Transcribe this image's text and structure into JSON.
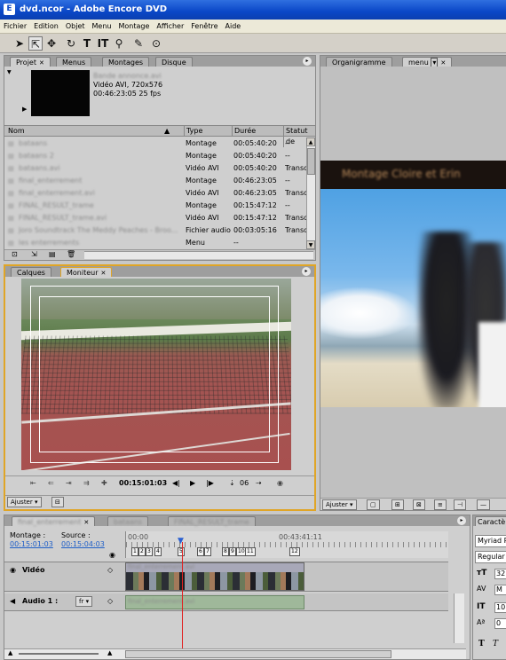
{
  "window": {
    "title": "dvd.ncor - Adobe Encore DVD",
    "icon": "app-icon"
  },
  "menu": [
    "Fichier",
    "Edition",
    "Objet",
    "Menu",
    "Montage",
    "Afficher",
    "Fenêtre",
    "Aide"
  ],
  "tools": [
    "selection-tool-icon",
    "direct-select-tool-icon",
    "move-tool-icon",
    "rotate-tool-icon",
    "text-tool-icon",
    "vertical-text-tool-icon",
    "zoom-tool-icon",
    "edit-tool-icon",
    "preview-tool-icon"
  ],
  "project": {
    "tabs": [
      "Projet",
      "Menus",
      "Montages",
      "Disque"
    ],
    "preview": {
      "name": "Bande annonce.avi",
      "type": "Vidéo AVI, 720x576",
      "duration": "00:46:23:05 25 fps"
    },
    "columns": [
      "Nom",
      "Type",
      "Durée",
      "Statut de"
    ],
    "rows": [
      {
        "name": "bataans",
        "type": "Montage",
        "duration": "00:05:40:20",
        "status": "--"
      },
      {
        "name": "bataans 2",
        "type": "Montage",
        "duration": "00:05:40:20",
        "status": "--"
      },
      {
        "name": "bataans.avi",
        "type": "Vidéo AVI",
        "duration": "00:05:40:20",
        "status": "Transc"
      },
      {
        "name": "final_enterrement",
        "type": "Montage",
        "duration": "00:46:23:05",
        "status": "--"
      },
      {
        "name": "final_enterrement.avi",
        "type": "Vidéo AVI",
        "duration": "00:46:23:05",
        "status": "Transc"
      },
      {
        "name": "FINAL_RESULT_trame",
        "type": "Montage",
        "duration": "00:15:47:12",
        "status": "--"
      },
      {
        "name": "FINAL_RESULT_trame.avi",
        "type": "Vidéo AVI",
        "duration": "00:15:47:12",
        "status": "Transc"
      },
      {
        "name": "Joro Soundtrack The Meddy Peaches - Broo...",
        "type": "Fichier audio",
        "duration": "00:03:05:16",
        "status": "Transc"
      },
      {
        "name": "les enterrements",
        "type": "Menu",
        "duration": "--",
        "status": ""
      }
    ]
  },
  "layers_monitor": {
    "tabs": [
      "Calques",
      "Moniteur"
    ]
  },
  "monitor": {
    "timecode": "00:15:01:03",
    "chapter": "06",
    "fit": "Ajuster"
  },
  "organigramme": {
    "tabs": [
      "Organigramme",
      "menu"
    ],
    "menu_text": "Montage Cloire et Erin",
    "fit": "Ajuster"
  },
  "timeline": {
    "tabs": [
      "final_enterrement",
      "bataans",
      "FINAL_RESULT_trame"
    ],
    "montage_label": "Montage :",
    "montage_tc": "00:15:01:03",
    "source_label": "Source :",
    "source_tc": "00:15:04:03",
    "ruler": [
      "00:00",
      "00:43:41:11"
    ],
    "chapters": [
      "1",
      "2",
      "3",
      "4",
      "5",
      "6",
      "7",
      "8",
      "9",
      "10",
      "11",
      "12"
    ],
    "video_label": "Vidéo",
    "video_clip": "final_enterrement.avi",
    "audio_label": "Audio 1 :",
    "audio_lang": "fr",
    "audio_clip": "final_enterrement.avi"
  },
  "character": {
    "tab": "Caractè",
    "font": "Myriad P",
    "style": "Regular",
    "values": [
      "32",
      "M",
      "10",
      "0"
    ]
  }
}
